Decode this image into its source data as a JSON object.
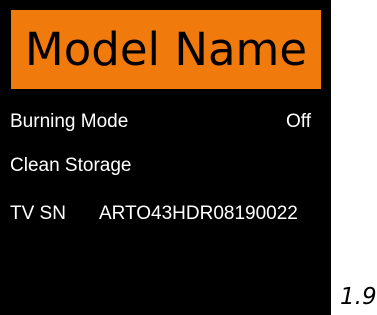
{
  "header": {
    "title": "Model Name",
    "accent_color": "#f07a0c"
  },
  "menu": {
    "burning_mode": {
      "label": "Burning Mode",
      "value": "Off"
    },
    "clean_storage": {
      "label": "Clean Storage"
    },
    "tv_sn": {
      "label": "TV SN",
      "value": "ARTO43HDR08190022"
    }
  },
  "version": "1.9"
}
